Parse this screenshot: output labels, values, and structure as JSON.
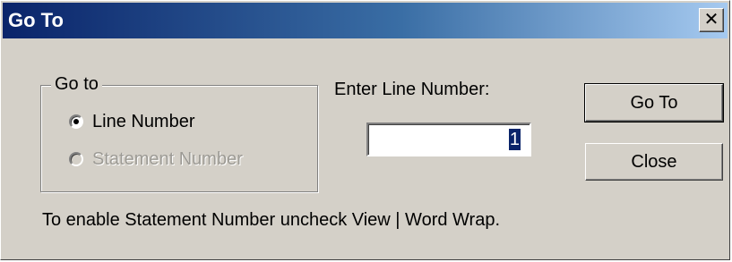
{
  "dialog": {
    "title": "Go To",
    "close_glyph": "✕"
  },
  "goto_group": {
    "legend": "Go to",
    "options": [
      {
        "label": "Line Number",
        "selected": true,
        "enabled": true
      },
      {
        "label": "Statement Number",
        "selected": false,
        "enabled": false
      }
    ]
  },
  "line_field": {
    "label": "Enter Line Number:",
    "value": "1"
  },
  "buttons": {
    "go_to": "Go To",
    "close": "Close"
  },
  "hint": "To enable Statement Number uncheck View | Word Wrap.",
  "colors": {
    "title_start": "#0a246a",
    "title_end": "#a6caf0",
    "face": "#d4d0c8"
  }
}
